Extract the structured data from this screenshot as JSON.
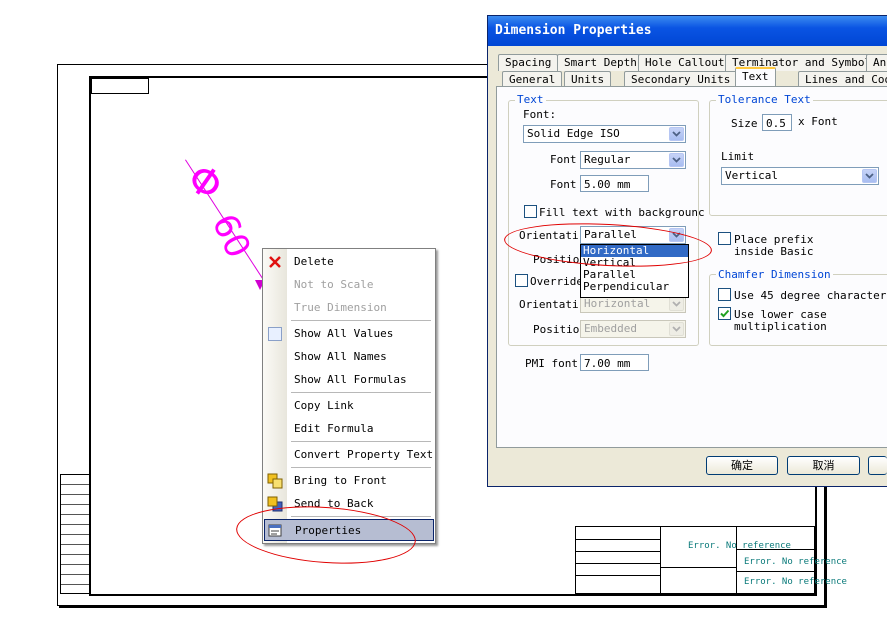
{
  "drawing": {
    "dimension_symbol": "Φ",
    "dimension_value": "60",
    "error_text_1": "Error. No reference",
    "error_text_2": "Error. No reference",
    "error_text_3": "Error. No reference"
  },
  "context_menu": {
    "items": [
      {
        "label": "Delete",
        "enabled": true,
        "icon": "delete-x-icon"
      },
      {
        "label": "Not to Scale",
        "enabled": false
      },
      {
        "label": "True Dimension",
        "enabled": false
      },
      {
        "label": "Show All Values",
        "enabled": true,
        "icon": "show-values-icon"
      },
      {
        "label": "Show All Names",
        "enabled": true
      },
      {
        "label": "Show All Formulas",
        "enabled": true
      },
      {
        "label": "Copy Link",
        "enabled": true
      },
      {
        "label": "Edit Formula",
        "enabled": true
      },
      {
        "label": "Convert Property Text",
        "enabled": true
      },
      {
        "label": "Bring to Front",
        "enabled": true,
        "icon": "bring-to-front-icon"
      },
      {
        "label": "Send to Back",
        "enabled": true,
        "icon": "send-to-back-icon"
      },
      {
        "label": "Properties",
        "enabled": true,
        "icon": "properties-icon",
        "selected": true
      }
    ]
  },
  "dialog": {
    "title": "Dimension Properties",
    "tabs_row1": [
      "Spacing",
      "Smart Depth",
      "Hole Callout",
      "Terminator and Symbol",
      "Ann"
    ],
    "tabs_row2": [
      "General",
      "Units",
      "Secondary Units",
      "Text",
      "Lines and Coo"
    ],
    "active_tab": "Text",
    "text_group": {
      "title": "Text",
      "font_label": "Font:",
      "font_value": "Solid Edge ISO",
      "style_label": "Font",
      "style_value": "Regular",
      "size_label": "Font",
      "size_value": "5.00 mm",
      "fill_label": "Fill text with backgrounc",
      "orientation_label": "Orientati",
      "orientation_value": "Parallel",
      "position_label": "Positio",
      "override_label": "Override",
      "orientation2_label": "Orientati",
      "orientation2_value": "Horizontal",
      "position2_label": "Positio",
      "position2_value": "Embedded",
      "pmi_font_label": "PMI font",
      "pmi_font_value": "7.00 mm"
    },
    "orientation_options": [
      "Horizontal",
      "Vertical",
      "Parallel",
      "Perpendicular"
    ],
    "selected_option": "Horizontal",
    "tolerance_group": {
      "title": "Tolerance Text",
      "size_label": "Size",
      "size_value": "0.5",
      "size_suffix": "x Font",
      "limit_label": "Limit",
      "limit_value": "Vertical"
    },
    "prefix": {
      "label_line1": "Place prefix",
      "label_line2": "inside Basic"
    },
    "chamfer_group": {
      "title": "Chamfer Dimension",
      "use45_label": "Use 45 degree character",
      "lowercase_label_line1": "Use lower case",
      "lowercase_label_line2": "multiplication",
      "use45_checked": false,
      "lowercase_checked": true
    },
    "buttons": {
      "ok": "确定",
      "cancel": "取消"
    }
  },
  "colors": {
    "dimension": "#ff00ff",
    "annotation_circle": "#e00000",
    "title_bar": "#0a54e3"
  }
}
